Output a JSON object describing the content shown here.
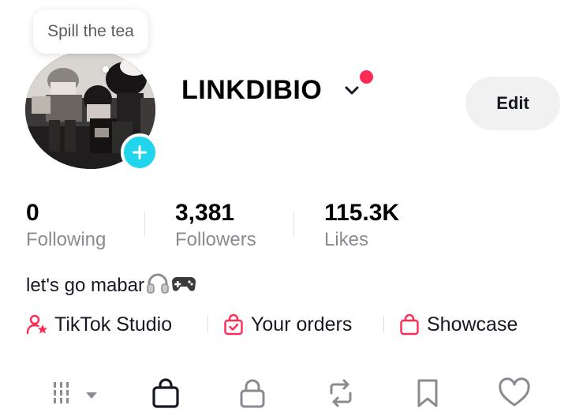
{
  "note": {
    "text": "Spill the tea"
  },
  "profile": {
    "username": "LINKDIBIO"
  },
  "actions": {
    "edit_label": "Edit"
  },
  "stats": [
    {
      "value": "0",
      "label": "Following"
    },
    {
      "value": "3,381",
      "label": "Followers"
    },
    {
      "value": "115.3K",
      "label": "Likes"
    }
  ],
  "bio": {
    "text": "let's go mabar"
  },
  "links": [
    {
      "label": "TikTok Studio",
      "icon": "creator-studio-icon"
    },
    {
      "label": "Your orders",
      "icon": "orders-bag-icon"
    },
    {
      "label": "Showcase",
      "icon": "showcase-bag-icon"
    }
  ],
  "tabs": [
    {
      "icon": "videos-grid-icon",
      "active": false
    },
    {
      "icon": "shop-bag-icon",
      "active": true
    },
    {
      "icon": "lock-icon",
      "active": false
    },
    {
      "icon": "repost-icon",
      "active": false
    },
    {
      "icon": "bookmark-icon",
      "active": false
    },
    {
      "icon": "heart-icon",
      "active": false
    }
  ],
  "colors": {
    "accent": "#fe2c55",
    "add_button": "#20d5ec",
    "muted_text": "#8a8b91",
    "edit_bg": "#f1f1f2"
  }
}
